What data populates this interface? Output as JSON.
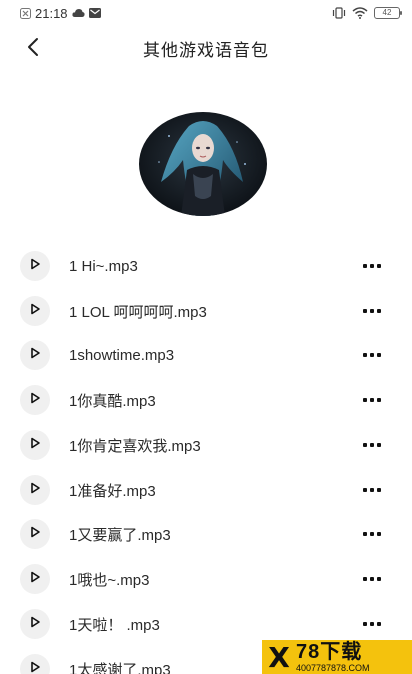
{
  "status_bar": {
    "time": "21:18",
    "battery": "42",
    "icons": [
      "notification-icon",
      "cloud-icon",
      "mail-icon",
      "vibrate-icon",
      "wifi-icon",
      "battery-icon"
    ]
  },
  "header": {
    "title": "其他游戏语音包",
    "back_icon": "chevron-left-icon"
  },
  "avatar": {
    "icon": "character-portrait"
  },
  "items": [
    {
      "label": "1 Hi~.mp3"
    },
    {
      "label": "1 LOL  呵呵呵呵.mp3"
    },
    {
      "label": "1showtime.mp3"
    },
    {
      "label": "1你真酷.mp3"
    },
    {
      "label": "1你肯定喜欢我.mp3"
    },
    {
      "label": "1准备好.mp3"
    },
    {
      "label": "1又要赢了.mp3"
    },
    {
      "label": "1哦也~.mp3"
    },
    {
      "label": "1天啦！ .mp3"
    },
    {
      "label": "1太感谢了.mp3"
    }
  ],
  "watermark": {
    "main": "78下载",
    "sub": "4007787878.COM"
  },
  "colors": {
    "play_bg": "#f0f0f0",
    "watermark_bg": "#f4c20d",
    "text": "#2a2a2a"
  }
}
